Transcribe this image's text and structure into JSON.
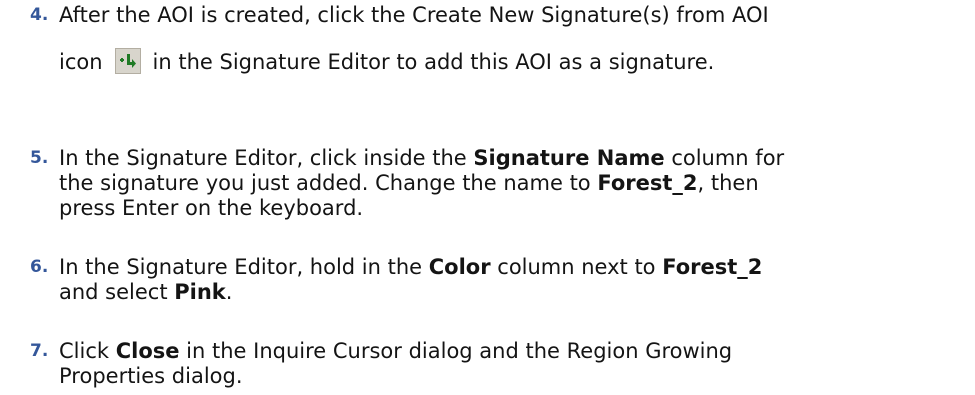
{
  "steps": [
    {
      "number": "4.",
      "line1": "After the AOI is created, click the Create New Signature(s) from AOI",
      "line2_before_icon": "icon",
      "icon": "create-signature-from-aoi-icon",
      "line2_after_icon": "in the Signature Editor to add this AOI as a signature."
    },
    {
      "number": "5.",
      "line1_a": "In the Signature Editor, click inside the ",
      "line1_bold": "Signature Name",
      "line1_b": " column for",
      "line2_a": "the signature you just added. Change the name to ",
      "line2_bold": "Forest_2",
      "line2_b": ", then",
      "line3": "press Enter on the keyboard."
    },
    {
      "number": "6.",
      "line1_a": "In the Signature Editor, hold in the ",
      "line1_bold1": "Color",
      "line1_b": " column next to ",
      "line1_bold2": "Forest_2",
      "line2_a": "and select ",
      "line2_bold": "Pink",
      "line2_b": "."
    },
    {
      "number": "7.",
      "line1_a": "Click ",
      "line1_bold": "Close",
      "line1_b": " in the Inquire Cursor dialog and the Region Growing",
      "line2": "Properties dialog."
    }
  ]
}
